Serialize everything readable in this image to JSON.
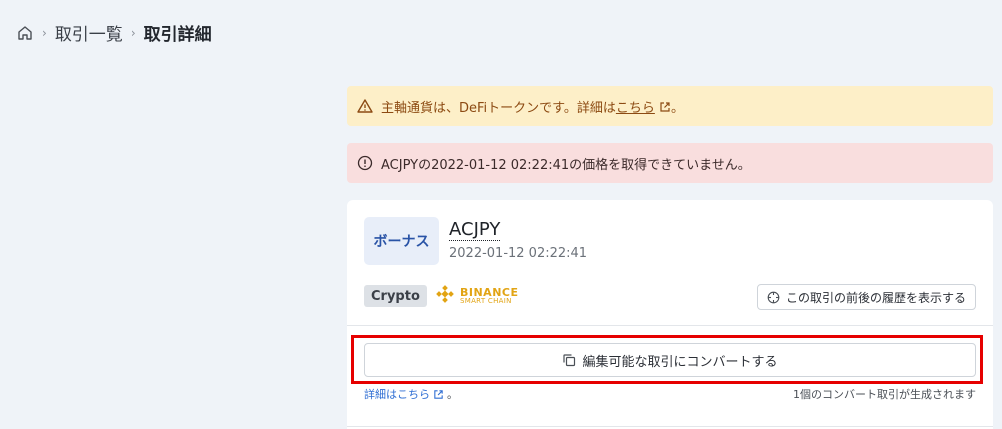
{
  "breadcrumb": {
    "items": [
      "取引一覧",
      "取引詳細"
    ]
  },
  "alerts": {
    "warning": {
      "text_before": "主軸通貨は、DeFiトークンです。詳細は",
      "link": "こちら",
      "text_after": "。"
    },
    "error": {
      "text": "ACJPYの2022-01-12 02:22:41の価格を取得できていません。"
    }
  },
  "transaction": {
    "type_badge": "ボーナス",
    "pair": "ACJPY",
    "timestamp": "2022-01-12 02:22:41",
    "tag": "Crypto",
    "chain": {
      "line1": "BINANCE",
      "line2": "SMART CHAIN"
    },
    "history_button": "この取引の前後の履歴を表示する",
    "convert_button": "編集可能な取引にコンバートする",
    "detail_link": "詳細はこちら",
    "detail_suffix": "。",
    "convert_note": "1個のコンバート取引が生成されます"
  },
  "colors": {
    "highlight": "#e60000",
    "warning_bg": "#fdefc8",
    "error_bg": "#f9dede",
    "bnb": "#e2a414"
  }
}
